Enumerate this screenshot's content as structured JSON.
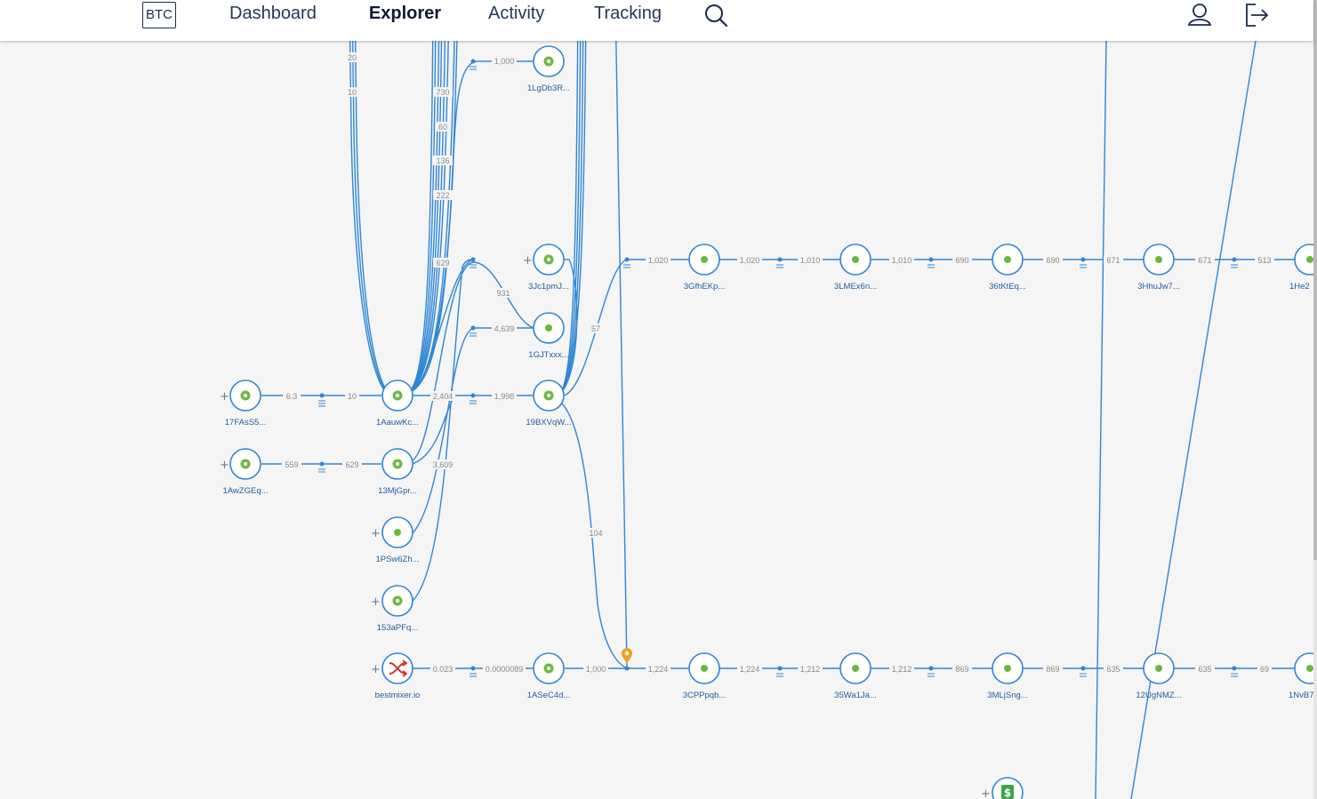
{
  "header": {
    "currency": "BTC",
    "tabs": [
      {
        "label": "Dashboard",
        "active": false
      },
      {
        "label": "Explorer",
        "active": true
      },
      {
        "label": "Activity",
        "active": false
      },
      {
        "label": "Tracking",
        "active": false
      }
    ],
    "icons": {
      "search": "search-icon",
      "user": "user-icon",
      "logout": "logout-icon"
    }
  },
  "colors": {
    "edge": "#2f86d6",
    "node_fill": "#6ab83e",
    "mixer": "#d0312d",
    "pin": "#f0a020",
    "nav_text": "#253858",
    "value_text": "#8a8a8a",
    "address_text": "#1f5d9f"
  },
  "graph": {
    "nodes": [
      {
        "id": "n1",
        "label": "17FAsS5...",
        "type": "address"
      },
      {
        "id": "n2",
        "label": "1AwZGEq...",
        "type": "address"
      },
      {
        "id": "n3",
        "label": "1AauwKc...",
        "type": "address"
      },
      {
        "id": "n4",
        "label": "13MjGpr...",
        "type": "address"
      },
      {
        "id": "n5",
        "label": "1PSw6Zh...",
        "type": "address-filled"
      },
      {
        "id": "n6",
        "label": "153aPFq...",
        "type": "address"
      },
      {
        "id": "n7",
        "label": "bestmixer.io",
        "type": "mixer"
      },
      {
        "id": "n8",
        "label": "1LgDb3R...",
        "type": "address"
      },
      {
        "id": "n9",
        "label": "3Jc1pmJ...",
        "type": "address"
      },
      {
        "id": "n10",
        "label": "1GJTxxx...",
        "type": "address-filled"
      },
      {
        "id": "n11",
        "label": "19BXVqW...",
        "type": "address"
      },
      {
        "id": "n12",
        "label": "1ASeC4d...",
        "type": "address"
      },
      {
        "id": "n13",
        "label": "3GfhEKp...",
        "type": "address-filled"
      },
      {
        "id": "n14",
        "label": "3LMEx6n...",
        "type": "address-filled"
      },
      {
        "id": "n15",
        "label": "36tKtEq...",
        "type": "address-filled"
      },
      {
        "id": "n16",
        "label": "3HhuJw7...",
        "type": "address-filled"
      },
      {
        "id": "n17",
        "label": "1He2",
        "type": "address-filled"
      },
      {
        "id": "n18",
        "label": "3CPPpqb...",
        "type": "address-filled"
      },
      {
        "id": "n19",
        "label": "35Wa1Ja...",
        "type": "address-filled"
      },
      {
        "id": "n20",
        "label": "3MLjSng...",
        "type": "address-filled"
      },
      {
        "id": "n21",
        "label": "12UgNMZ...",
        "type": "address-filled"
      },
      {
        "id": "n22",
        "label": "1NvB7",
        "type": "address-filled"
      },
      {
        "id": "n23",
        "label": "",
        "type": "exchange"
      }
    ],
    "values": {
      "top_20": "20",
      "top_10": "10",
      "v730": "730",
      "v60": "60",
      "v136": "136",
      "v222": "222",
      "v629_top": "629",
      "v1000_top": "1,000",
      "v931": "931",
      "v4639": "4,639",
      "v57": "57",
      "v6_3": "6.3",
      "v10": "10",
      "v2404": "2,404",
      "v1998": "1,998",
      "v559": "559",
      "v629": "629",
      "v3609": "3,609",
      "v104": "104",
      "v0_023": "0.023",
      "v0_0000089": "0.0000089",
      "v1000": "1,000",
      "r1a": "1,020",
      "r1b": "1,020",
      "r1c": "1,010",
      "r1d": "1,010",
      "r1e": "690",
      "r1f": "690",
      "r1g": "671",
      "r1h": "671",
      "r1i": "513",
      "r2a": "1,224",
      "r2b": "1,224",
      "r2c": "1,212",
      "r2d": "1,212",
      "r2e": "869",
      "r2f": "869",
      "r2g": "635",
      "r2h": "635",
      "r2i": "69"
    }
  }
}
